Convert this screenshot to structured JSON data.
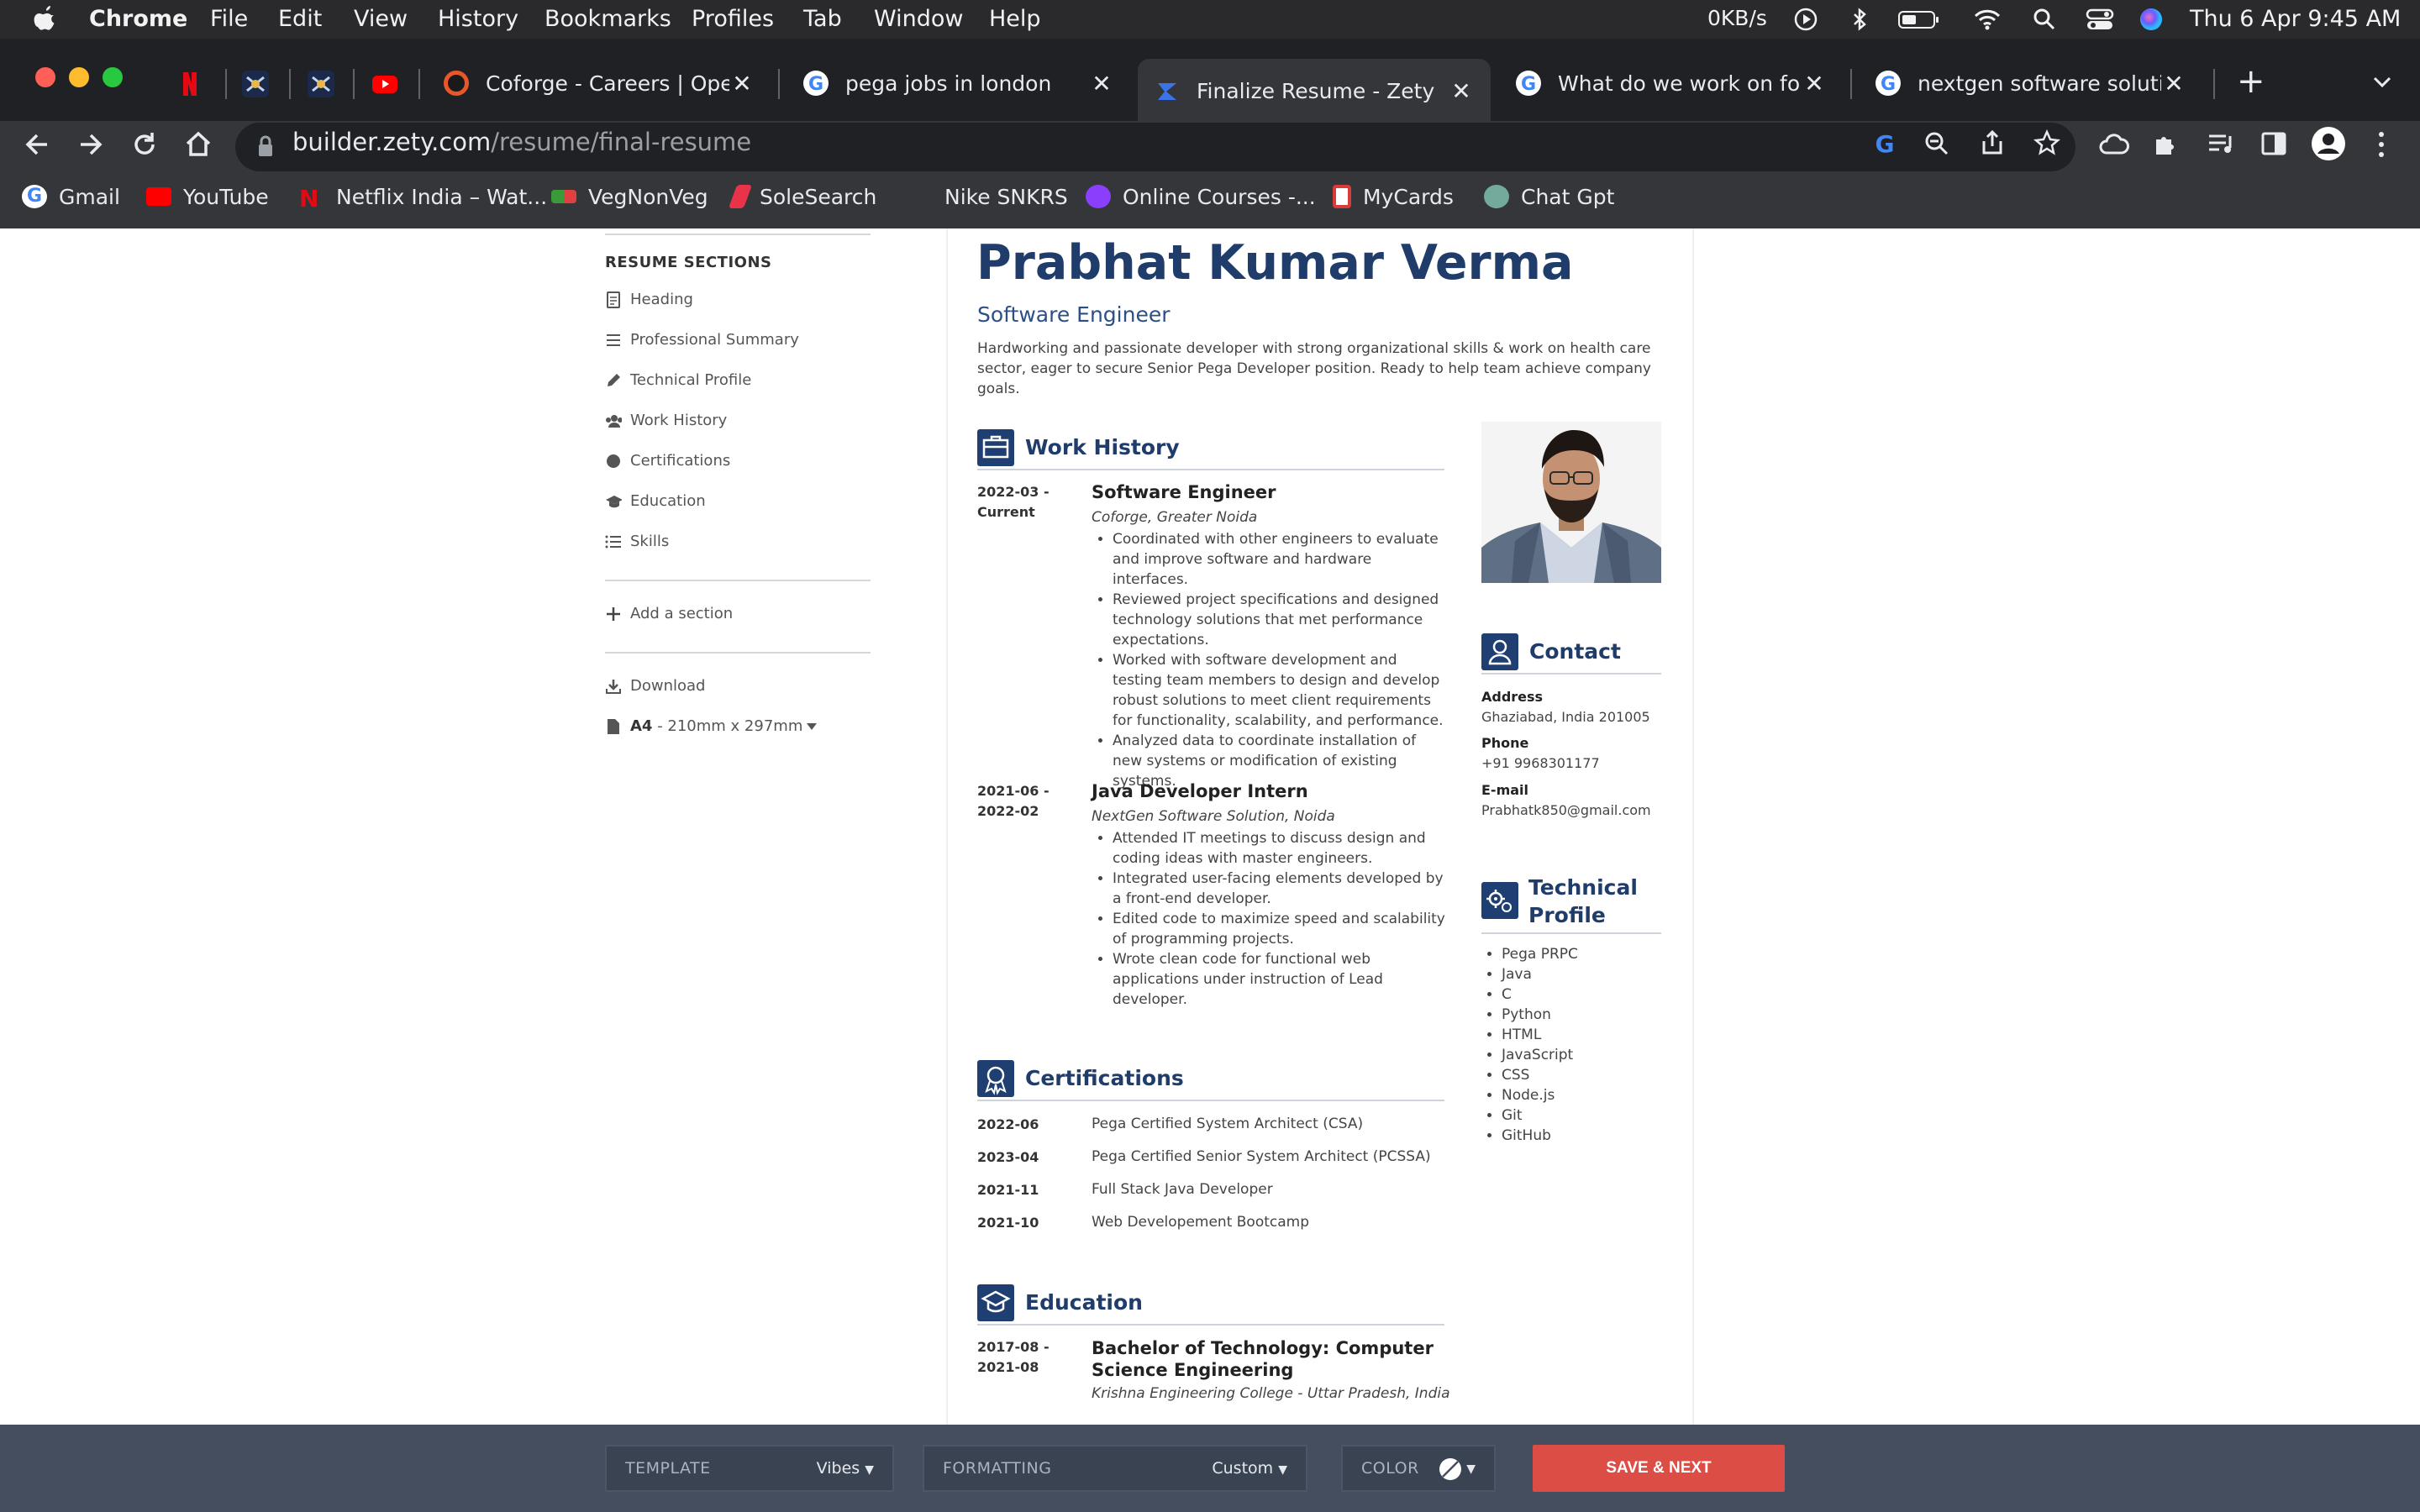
{
  "menubar": {
    "app": "Chrome",
    "items": [
      "File",
      "Edit",
      "View",
      "History",
      "Bookmarks",
      "Profiles",
      "Tab",
      "Window",
      "Help"
    ],
    "net_speed": "0KB/s",
    "datetime": "Thu 6 Apr  9:45 AM"
  },
  "tabs": [
    {
      "title": "Coforge - Careers | Open Jobs"
    },
    {
      "title": "pega jobs in london"
    },
    {
      "title": "Finalize Resume - Zety",
      "active": true
    },
    {
      "title": "What do we work on for pega"
    },
    {
      "title": "nextgen software solutions"
    }
  ],
  "address": {
    "host": "builder.zety.com",
    "path": "/resume/final-resume"
  },
  "bookmarks": [
    "Gmail",
    "YouTube",
    "Netflix India – Wat...",
    "VegNonVeg",
    "SoleSearch",
    "Nike SNKRS",
    "Online Courses -...",
    "MyCards",
    "Chat Gpt"
  ],
  "sidebar": {
    "title": "RESUME SECTIONS",
    "sections": [
      "Heading",
      "Professional Summary",
      "Technical Profile",
      "Work History",
      "Certifications",
      "Education",
      "Skills"
    ],
    "add_section": "Add a section",
    "download": "Download",
    "paper_bold": "A4",
    "paper_rest": " - 210mm x 297mm"
  },
  "resume": {
    "name": "Prabhat Kumar Verma",
    "title": "Software Engineer",
    "summary": "Hardworking and passionate developer with strong organizational skills & work on health care sector, eager to secure Senior Pega Developer position. Ready to help team achieve company goals.",
    "work_heading": "Work History",
    "jobs": [
      {
        "date1": "2022-03 -",
        "date2": "Current",
        "title": "Software Engineer",
        "company": "Coforge, Greater Noida",
        "bullets": [
          "Coordinated with other engineers to evaluate and improve software and hardware interfaces.",
          "Reviewed project specifications and designed technology solutions that met performance expectations.",
          "Worked with software development and testing team members to design and develop robust solutions to meet client requirements for functionality, scalability, and performance.",
          "Analyzed data to coordinate installation of new systems or modification of existing systems."
        ]
      },
      {
        "date1": "2021-06 -",
        "date2": "2022-02",
        "title": "Java Developer Intern",
        "company": "NextGen Software Solution, Noida",
        "bullets": [
          "Attended IT meetings to discuss design and coding ideas with master engineers.",
          "Integrated user-facing elements developed by a front-end developer.",
          "Edited code to maximize speed and scalability of programming projects.",
          "Wrote clean code for functional web applications under instruction of Lead developer."
        ]
      }
    ],
    "cert_heading": "Certifications",
    "certifications": [
      {
        "date": "2022-06",
        "name": "Pega Certified System Architect (CSA)"
      },
      {
        "date": "2023-04",
        "name": "Pega Certified Senior System Architect (PCSSA)"
      },
      {
        "date": "2021-11",
        "name": "Full Stack Java Developer"
      },
      {
        "date": "2021-10",
        "name": "Web Developement Bootcamp"
      }
    ],
    "edu_heading": "Education",
    "education": [
      {
        "date1": "2017-08 -",
        "date2": "2021-08",
        "degree": "Bachelor of Technology: Computer Science Engineering",
        "school": "Krishna Engineering College - Uttar Pradesh, India"
      }
    ],
    "contact_heading": "Contact",
    "contact": {
      "address_label": "Address",
      "address": "Ghaziabad, India 201005",
      "phone_label": "Phone",
      "phone": "+91 9968301177",
      "email_label": "E-mail",
      "email": "Prabhatk850@gmail.com"
    },
    "tech_heading_1": "Technical",
    "tech_heading_2": "Profile",
    "technical_profile": [
      "Pega PRPC",
      "Java",
      "C",
      "Python",
      "HTML",
      "JavaScript",
      "CSS",
      "Node.js",
      "Git",
      "GitHub"
    ]
  },
  "bottombar": {
    "template_label": "TEMPLATE",
    "template_value": "Vibes",
    "formatting_label": "FORMATTING",
    "formatting_value": "Custom",
    "color_label": "COLOR",
    "save_label": "SAVE & NEXT"
  },
  "colors": {
    "accent": "#203c6b",
    "save": "#dc4d45",
    "bottombar": "#444e5e"
  }
}
